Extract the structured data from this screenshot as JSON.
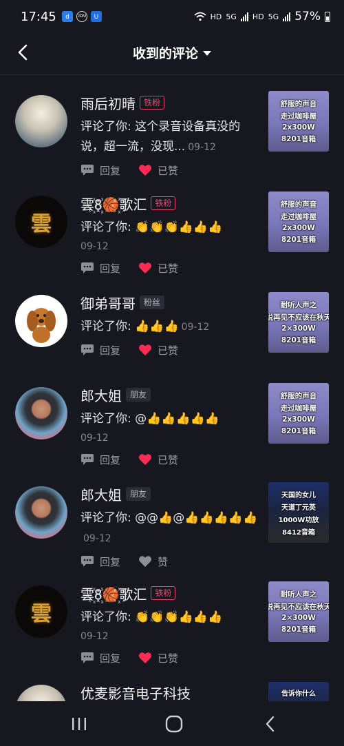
{
  "status_bar": {
    "time": "17:45",
    "apps": [
      "d",
      "JDM",
      "U"
    ],
    "network": [
      "HD",
      "5G",
      "HD",
      "5G"
    ],
    "battery": "57%"
  },
  "header": {
    "title": "收到的评论"
  },
  "comments": [
    {
      "name": "雨后初晴",
      "badge": "铁粉",
      "badge_style": "iron",
      "comment": "评论了你: 这个录音设备真没的说，超一流，没现...",
      "time": "09-12",
      "reply": "回复",
      "like": "已赞",
      "liked": true,
      "avatar": "dream",
      "thumb": {
        "style": "lav",
        "lines": [
          "舒服的声音",
          "走过咖啡屋",
          "2x300W",
          "8201音箱"
        ]
      }
    },
    {
      "name": "雲꙰8꙰🏀꙰歌汇",
      "badge": "铁粉",
      "badge_style": "iron",
      "comment": "评论了你: 👏👏👏👍👍👍",
      "time": "09-12",
      "reply": "回复",
      "like": "已赞",
      "liked": true,
      "avatar": "gold",
      "thumb": {
        "style": "lav",
        "lines": [
          "舒服的声音",
          "走过咖啡屋",
          "2x300W",
          "8201音箱"
        ]
      }
    },
    {
      "name": "御弟哥哥",
      "badge": "粉丝",
      "badge_style": "grey",
      "comment": "评论了你: 👍👍👍",
      "time": "09-12",
      "reply": "回复",
      "like": "已赞",
      "liked": true,
      "avatar": "dog",
      "thumb": {
        "style": "lav",
        "lines": [
          "耐听人声之",
          "说再见不应该在秋天",
          "2×300W",
          "8201音箱"
        ]
      }
    },
    {
      "name": "郎大姐",
      "badge": "朋友",
      "badge_style": "grey",
      "comment": "评论了你: @👍👍👍👍👍",
      "time": "09-12",
      "reply": "回复",
      "like": "已赞",
      "liked": true,
      "avatar": "woman",
      "thumb": {
        "style": "lav",
        "lines": [
          "舒服的声音",
          "走过咖啡屋",
          "2x300W",
          "8201音箱"
        ]
      }
    },
    {
      "name": "郎大姐",
      "badge": "朋友",
      "badge_style": "grey",
      "comment": "评论了你: @@👍@👍👍👍👍👍",
      "time": "09-12",
      "reply": "回复",
      "like": "赞",
      "liked": false,
      "avatar": "woman",
      "thumb": {
        "style": "dark",
        "lines": [
          "天国的女儿",
          "天道丁元英",
          "1000W功放",
          "8412音箱"
        ]
      }
    },
    {
      "name": "雲꙰8꙰🏀꙰歌汇",
      "badge": "铁粉",
      "badge_style": "iron",
      "comment": "评论了你: 👏👏👏👍👍👍",
      "time": "09-12",
      "reply": "回复",
      "like": "已赞",
      "liked": true,
      "avatar": "gold",
      "thumb": {
        "style": "lav",
        "lines": [
          "耐听人声之",
          "说再见不应该在秋天",
          "2×300W",
          "8201音箱"
        ]
      }
    },
    {
      "name": "优麦影音电子科技",
      "badge": "",
      "badge_style": "none",
      "comment": "",
      "time": "",
      "reply": "",
      "like": "",
      "liked": false,
      "avatar": "dream",
      "thumb": {
        "style": "dark",
        "lines": [
          "告诉你什么"
        ]
      }
    }
  ],
  "colors": {
    "background": "#16171f",
    "accent": "#fe2c55",
    "badge_iron": "#e8456b"
  }
}
